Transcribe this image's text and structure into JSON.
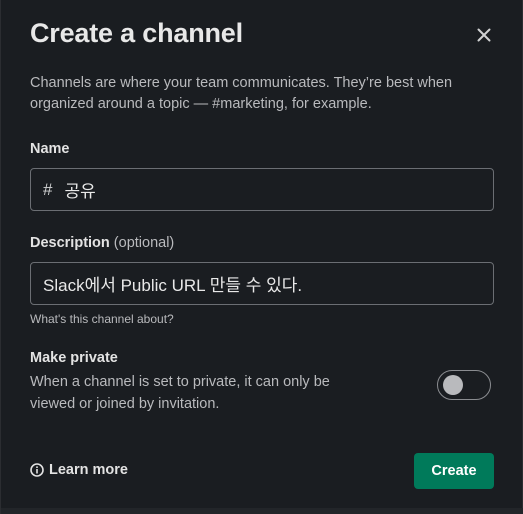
{
  "dialog": {
    "title": "Create a channel",
    "intro": "Channels are where your team communicates. They’re best when organized around a topic — #marketing, for example."
  },
  "name_field": {
    "label": "Name",
    "prefix": "#",
    "value": "공유"
  },
  "description_field": {
    "label": "Description",
    "optional": "(optional)",
    "value": "Slack에서 Public URL 만들 수 있다.",
    "hint": "What's this channel about?"
  },
  "private": {
    "label": "Make private",
    "description": "When a channel is set to private, it can only be viewed or joined by invitation.",
    "enabled": false
  },
  "footer": {
    "learn_more": "Learn more",
    "create_label": "Create"
  },
  "colors": {
    "background": "#1a1d21",
    "accent": "#007a5a"
  },
  "icons": {
    "close": "close-icon",
    "info": "info-icon"
  }
}
